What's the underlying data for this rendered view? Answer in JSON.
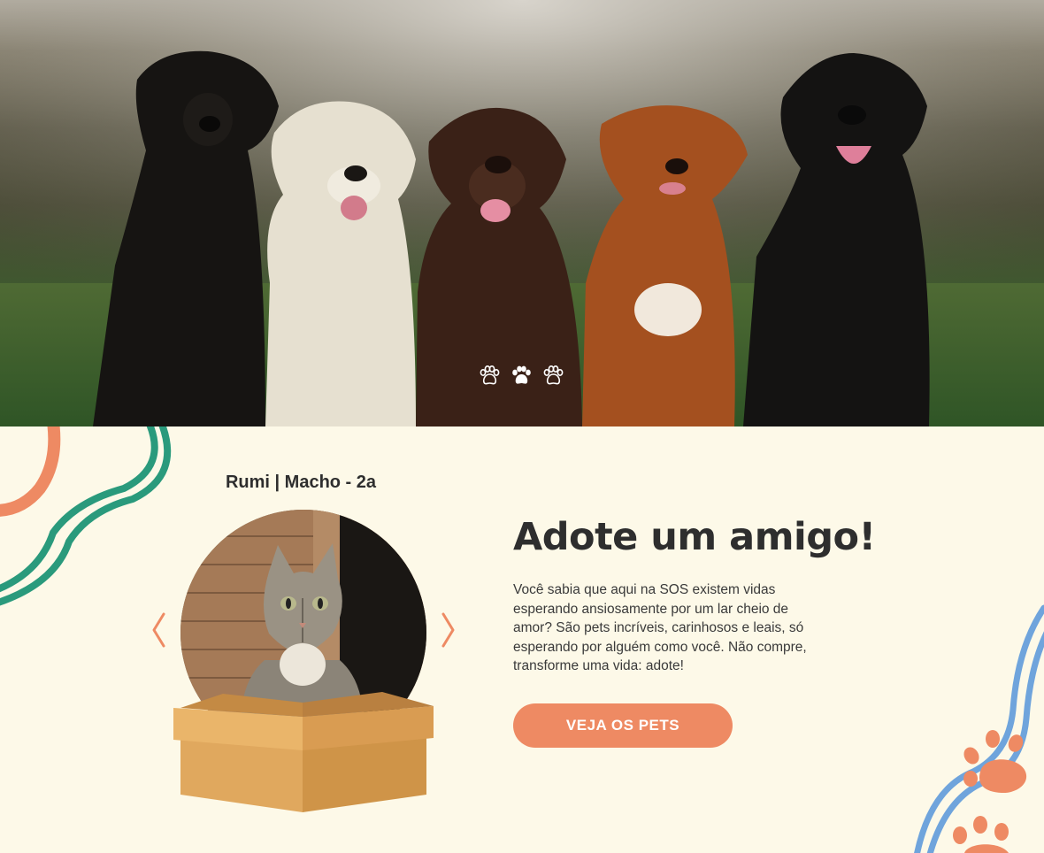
{
  "hero": {
    "carousel": {
      "count": 3,
      "active_index": 1
    }
  },
  "pet": {
    "caption": "Rumi | Macho - 2a"
  },
  "adopt": {
    "title": "Adote um amigo!",
    "description": "Você sabia que aqui na SOS existem vidas esperando ansiosamente por um lar cheio de amor? São pets incríveis, carinhosos e leais, só esperando por alguém como você. Não compre, transforme uma vida: adote!",
    "cta_label": "VEJA OS PETS"
  },
  "colors": {
    "background": "#fdf9e8",
    "accent_orange": "#ee8a63",
    "accent_green": "#2a9a7c",
    "accent_blue": "#6fa4dc",
    "text_dark": "#2e2e2e"
  },
  "icons": {
    "carousel_dot": "paw-icon",
    "prev": "chevron-left-icon",
    "next": "chevron-right-icon"
  }
}
